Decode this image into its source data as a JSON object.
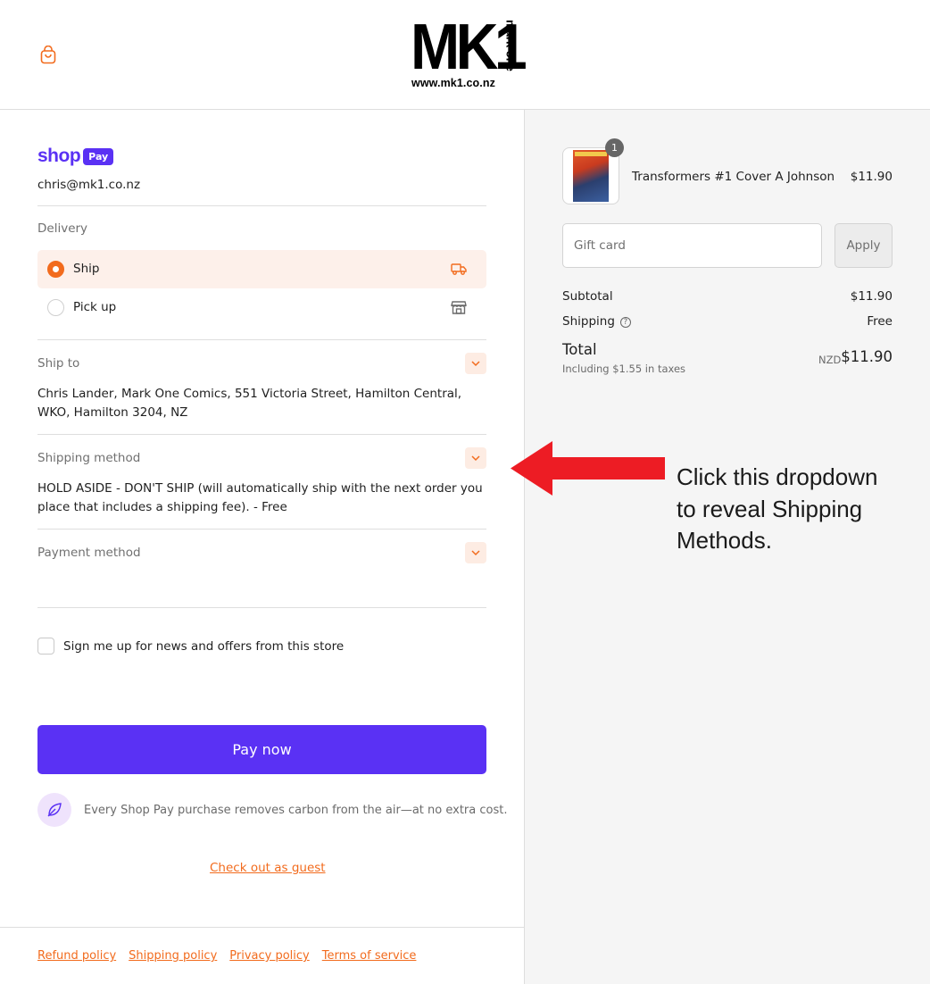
{
  "header": {
    "logo_main": "MK1",
    "logo_side": "mark one",
    "logo_url": "www.mk1.co.nz",
    "bag_icon": "shopping-bag-icon"
  },
  "express": {
    "shop_text": "shop",
    "pay_text": "Pay",
    "email": "chris@mk1.co.nz"
  },
  "delivery": {
    "label": "Delivery",
    "options": [
      {
        "label": "Ship",
        "selected": true,
        "icon": "truck-icon"
      },
      {
        "label": "Pick up",
        "selected": false,
        "icon": "store-icon"
      }
    ]
  },
  "ship_to": {
    "label": "Ship to",
    "address": "Chris Lander, Mark One Comics, 551 Victoria Street, Hamilton Central, WKO, Hamilton 3204, NZ"
  },
  "shipping_method": {
    "label": "Shipping method",
    "value": "HOLD ASIDE - DON'T SHIP (will automatically ship with the next order you place that includes a shipping fee). - Free"
  },
  "payment_method": {
    "label": "Payment method"
  },
  "newsletter": {
    "label": "Sign me up for news and offers from this store",
    "checked": false
  },
  "pay_button": "Pay now",
  "carbon_note": "Every Shop Pay purchase removes carbon from the air—at no extra cost.",
  "guest_link": "Check out as guest",
  "footer": {
    "links": [
      "Refund policy",
      "Shipping policy",
      "Privacy policy",
      "Terms of service"
    ]
  },
  "order": {
    "item": {
      "title": "Transformers #1 Cover A Johnson",
      "price": "$11.90",
      "quantity": "1"
    },
    "gift_card": {
      "placeholder": "Gift card",
      "apply_label": "Apply"
    },
    "subtotal_label": "Subtotal",
    "subtotal": "$11.90",
    "shipping_label": "Shipping",
    "shipping_value": "Free",
    "total_label": "Total",
    "tax_note": "Including $1.55 in taxes",
    "currency": "NZD",
    "total": "$11.90"
  },
  "annotation": {
    "text": "Click this dropdown to reveal Shipping Methods.",
    "arrow_color": "#ed1c24"
  },
  "colors": {
    "accent": "#f26b1d",
    "shop_pay": "#5a31f4",
    "selected_bg": "#fdf0ea"
  }
}
